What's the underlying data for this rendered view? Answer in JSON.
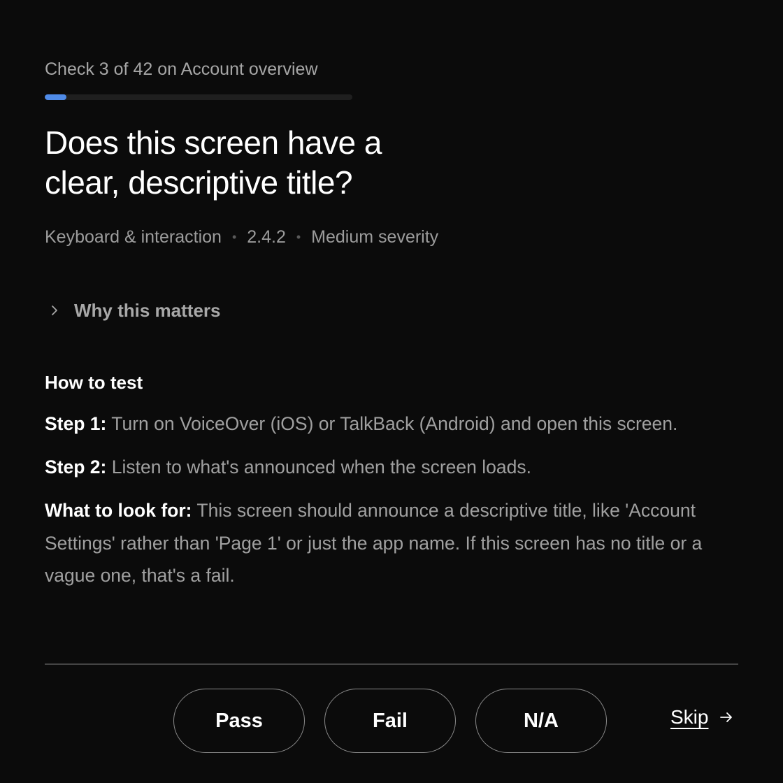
{
  "progress": {
    "label": "Check 3 of 42 on Account overview",
    "current": 3,
    "total": 42,
    "color": "#4f8be8"
  },
  "question": "Does this screen have a clear, descriptive title?",
  "meta": {
    "category": "Keyboard & interaction",
    "criterion": "2.4.2",
    "severity": "Medium severity",
    "separator": "•"
  },
  "why": {
    "label": "Why this matters",
    "icon": "chevron-right-icon"
  },
  "how_to_test": {
    "title": "How to test",
    "steps": [
      {
        "label": "Step 1:",
        "text": "Turn on VoiceOver (iOS) or TalkBack (Android) and open this screen."
      },
      {
        "label": "Step 2:",
        "text": "Listen to what's announced when the screen loads."
      },
      {
        "label": "What to look for:",
        "text": "This screen should announce a descriptive title, like 'Account Settings' rather than 'Page 1' or just the app name. If this screen has no title or a vague one, that's a fail."
      }
    ]
  },
  "actions": {
    "pass": "Pass",
    "fail": "Fail",
    "na": "N/A",
    "skip": "Skip",
    "skip_icon": "arrow-right-icon"
  }
}
